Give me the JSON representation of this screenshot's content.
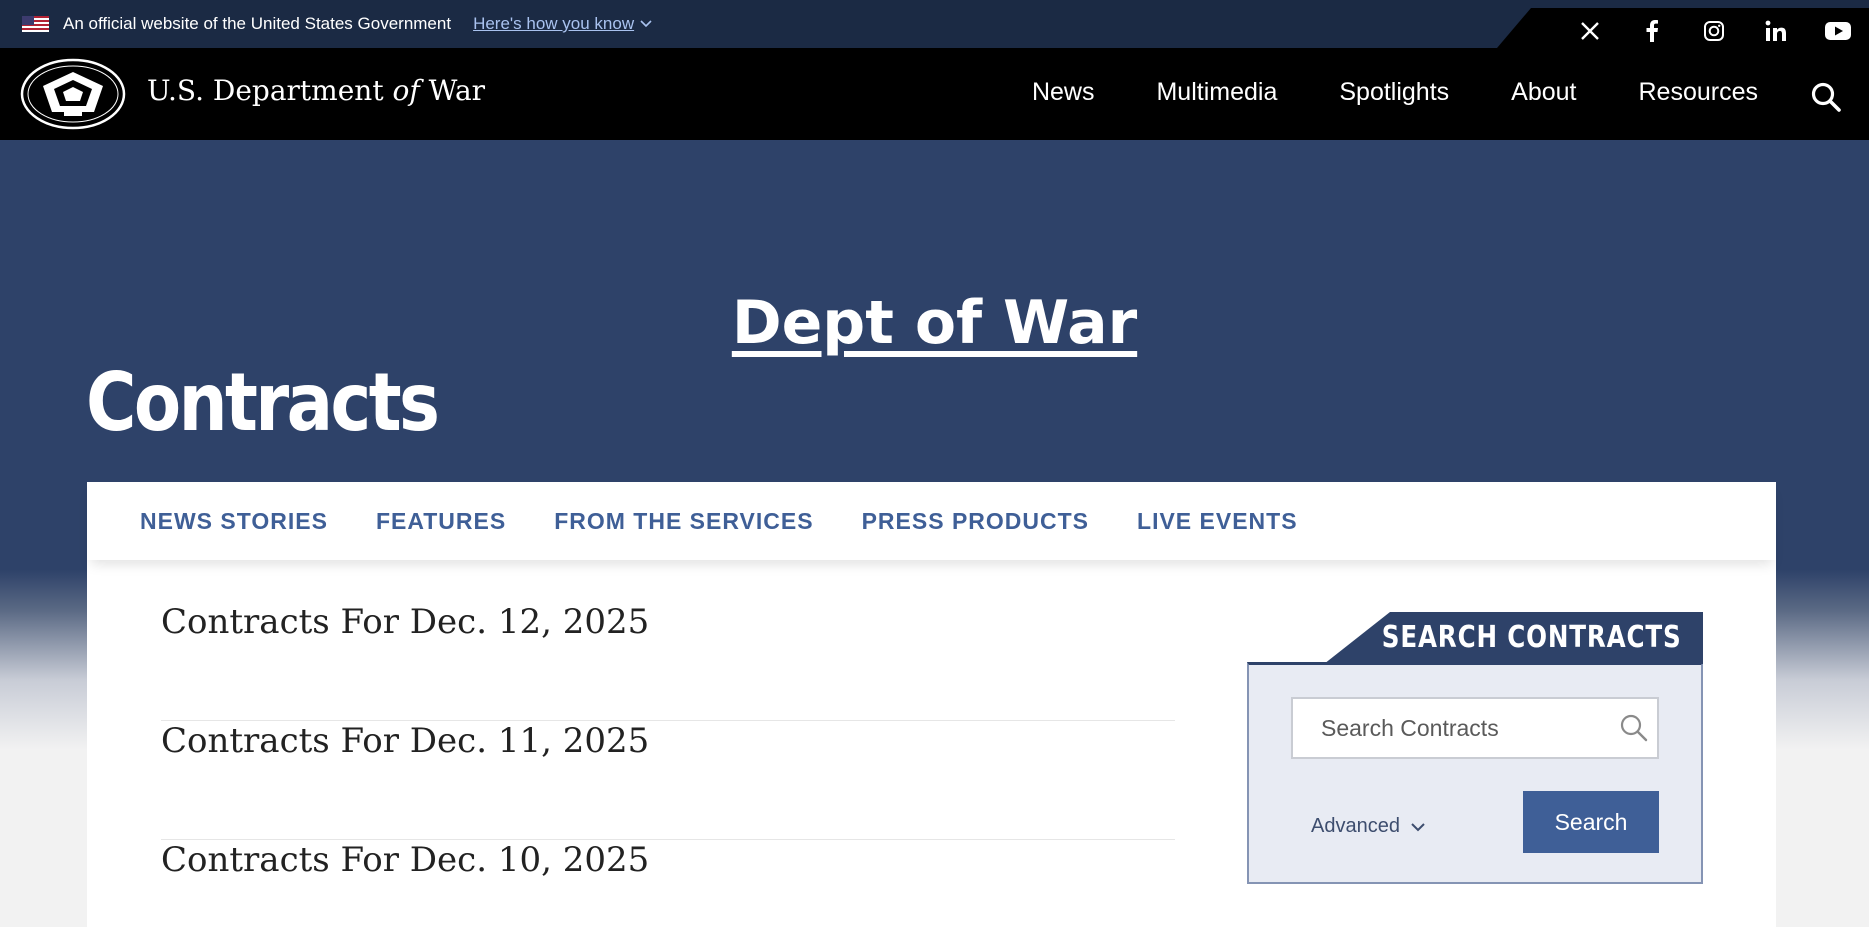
{
  "gov_banner": {
    "official_text": "An official website of the United States Government",
    "how_you_know": "Here's how you know"
  },
  "social": {
    "icons": [
      "x-icon",
      "facebook-icon",
      "instagram-icon",
      "linkedin-icon",
      "youtube-icon"
    ]
  },
  "header": {
    "site_name_pre": "U.S. Department",
    "site_name_of": "of",
    "site_name_post": "War",
    "nav": [
      "News",
      "Multimedia",
      "Spotlights",
      "About",
      "Resources"
    ]
  },
  "hero": {
    "link_text": "Dept of War",
    "title": "Contracts"
  },
  "subnav": [
    "NEWS STORIES",
    "FEATURES",
    "FROM THE SERVICES",
    "PRESS PRODUCTS",
    "LIVE EVENTS"
  ],
  "contracts": [
    "Contracts For Dec. 12, 2025",
    "Contracts For Dec. 11, 2025",
    "Contracts For Dec. 10, 2025"
  ],
  "search_widget": {
    "heading": "SEARCH CONTRACTS",
    "placeholder": "Search Contracts",
    "advanced_label": "Advanced",
    "button_label": "Search"
  },
  "colors": {
    "hero_bg": "#2e4269",
    "accent": "#3f5f97",
    "nav_bg": "#000000",
    "banner_bg": "#1b2a44"
  }
}
